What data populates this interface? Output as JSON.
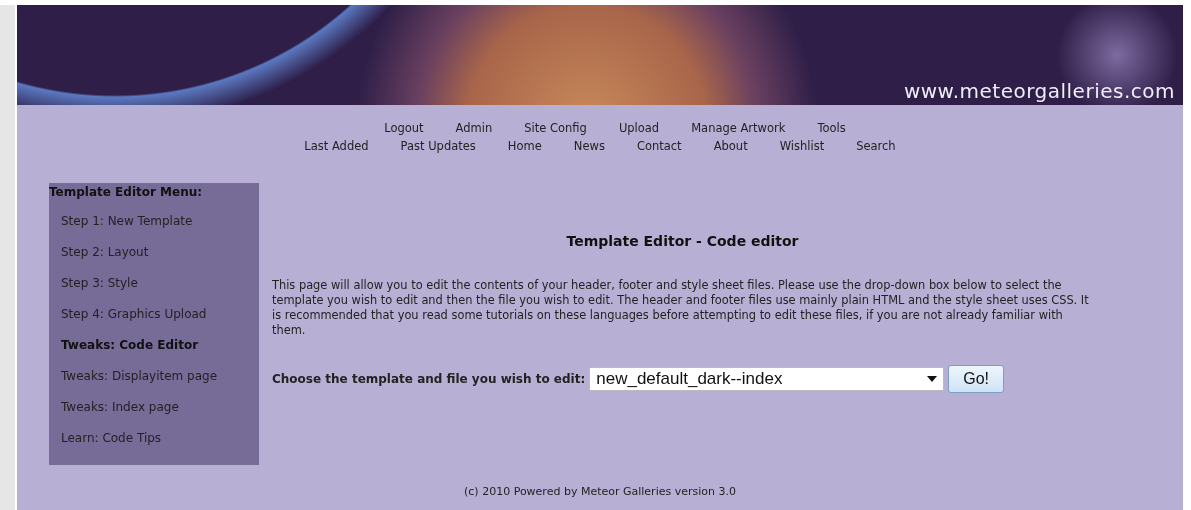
{
  "banner": {
    "site_url": "www.meteorgalleries.com"
  },
  "nav": {
    "admin_links": [
      "Logout",
      "Admin",
      "Site Config",
      "Upload",
      "Manage Artwork",
      "Tools"
    ],
    "public_links": [
      "Last Added",
      "Past Updates",
      "Home",
      "News",
      "Contact",
      "About",
      "Wishlist",
      "Search"
    ]
  },
  "sidebar": {
    "title": "Template Editor Menu:",
    "items": [
      {
        "label": "Step 1: New Template",
        "selected": false
      },
      {
        "label": "Step 2: Layout",
        "selected": false
      },
      {
        "label": "Step 3: Style",
        "selected": false
      },
      {
        "label": "Step 4: Graphics Upload",
        "selected": false
      },
      {
        "label": "Tweaks: Code Editor",
        "selected": true
      },
      {
        "label": "Tweaks: Displayitem page",
        "selected": false
      },
      {
        "label": "Tweaks: Index page",
        "selected": false
      },
      {
        "label": "Learn: Code Tips",
        "selected": false
      }
    ]
  },
  "main": {
    "title": "Template Editor - Code editor",
    "intro": "This page will allow you to edit the contents of your header, footer and style sheet files. Please use the drop-down box below to select the template you wish to edit and then the file you wish to edit. The header and footer files use mainly plain HTML and the style sheet uses CSS. It is recommended that you read some tutorials on these languages before attempting to edit these files, if you are not already familiar with them.",
    "chooser": {
      "label": "Choose the template and file you wish to edit:",
      "value": "new_default_dark--index",
      "button": "Go!"
    }
  },
  "footer": "(c) 2010 Powered by Meteor Galleries version 3.0"
}
